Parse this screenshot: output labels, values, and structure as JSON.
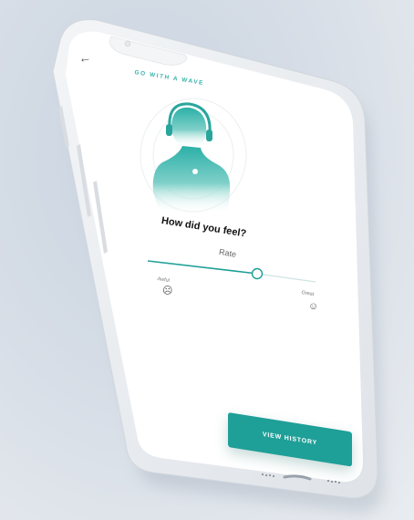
{
  "app": {
    "brand_title": "GO WITH A WAVE"
  },
  "nav": {
    "back_icon": "arrow-left-icon",
    "back_glyph": "←"
  },
  "survey": {
    "question": "How did you feel?",
    "rate_label": "Rate",
    "slider_value_fraction": 0.62,
    "min_label": "Awful",
    "max_label": "Great",
    "min_icon": "sad-face-icon",
    "max_icon": "happy-face-icon",
    "min_glyph": "☹",
    "max_glyph": "☺"
  },
  "actions": {
    "history_label": "VIEW HISTORY"
  },
  "colors": {
    "accent": "#1e9f97",
    "accent_light": "#39b3ad",
    "background": "#e7eaef",
    "screen": "#ffffff"
  }
}
